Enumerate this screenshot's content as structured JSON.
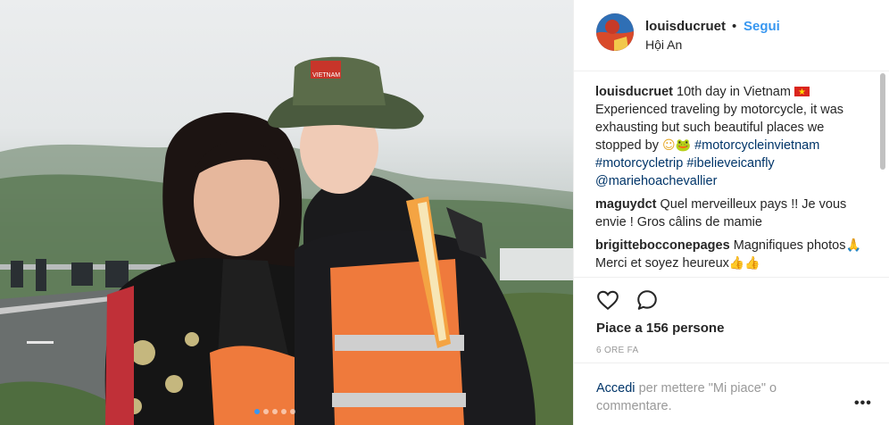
{
  "post": {
    "username": "louisducruet",
    "bullet": "•",
    "follow_label": "Segui",
    "location": "Hội An"
  },
  "caption": {
    "username": "louisducruet",
    "text_1": "10th day in Vietnam",
    "text_2": "Experienced traveling by motorcycle, it was exhausting but such beautiful places we stopped by",
    "emoji_1": "☺",
    "emoji_2": "🐸",
    "hashtag_1": "#motorcycleinvietnam",
    "hashtag_2": "#motorcycletrip",
    "hashtag_3": "#ibelieveicanfly",
    "mention": "@mariehoachevallier"
  },
  "comments": [
    {
      "username": "maguydct",
      "text": "Quel merveilleux pays !! Je vous envie ! Gros câlins de mamie"
    },
    {
      "username": "brigittebocconepages",
      "text_1": "Magnifiques photos",
      "emoji_pray": "🙏",
      "text_2": "Merci et soyez heureux",
      "emoji_thumbs": "👍👍"
    }
  ],
  "actions": {
    "likes_text": "Piace a 156 persone",
    "time_text": "6 ORE FA"
  },
  "footer": {
    "login_link": "Accedi",
    "login_rest": "per mettere \"Mi piace\" o commentare.",
    "more_label": "•••"
  },
  "colors": {
    "link_blue": "#3897f0",
    "hashtag_blue": "#003569",
    "text": "#262626",
    "muted": "#999999"
  },
  "icons": [
    "heart-icon",
    "comment-icon",
    "flag-vietnam-icon",
    "more-options-icon"
  ]
}
